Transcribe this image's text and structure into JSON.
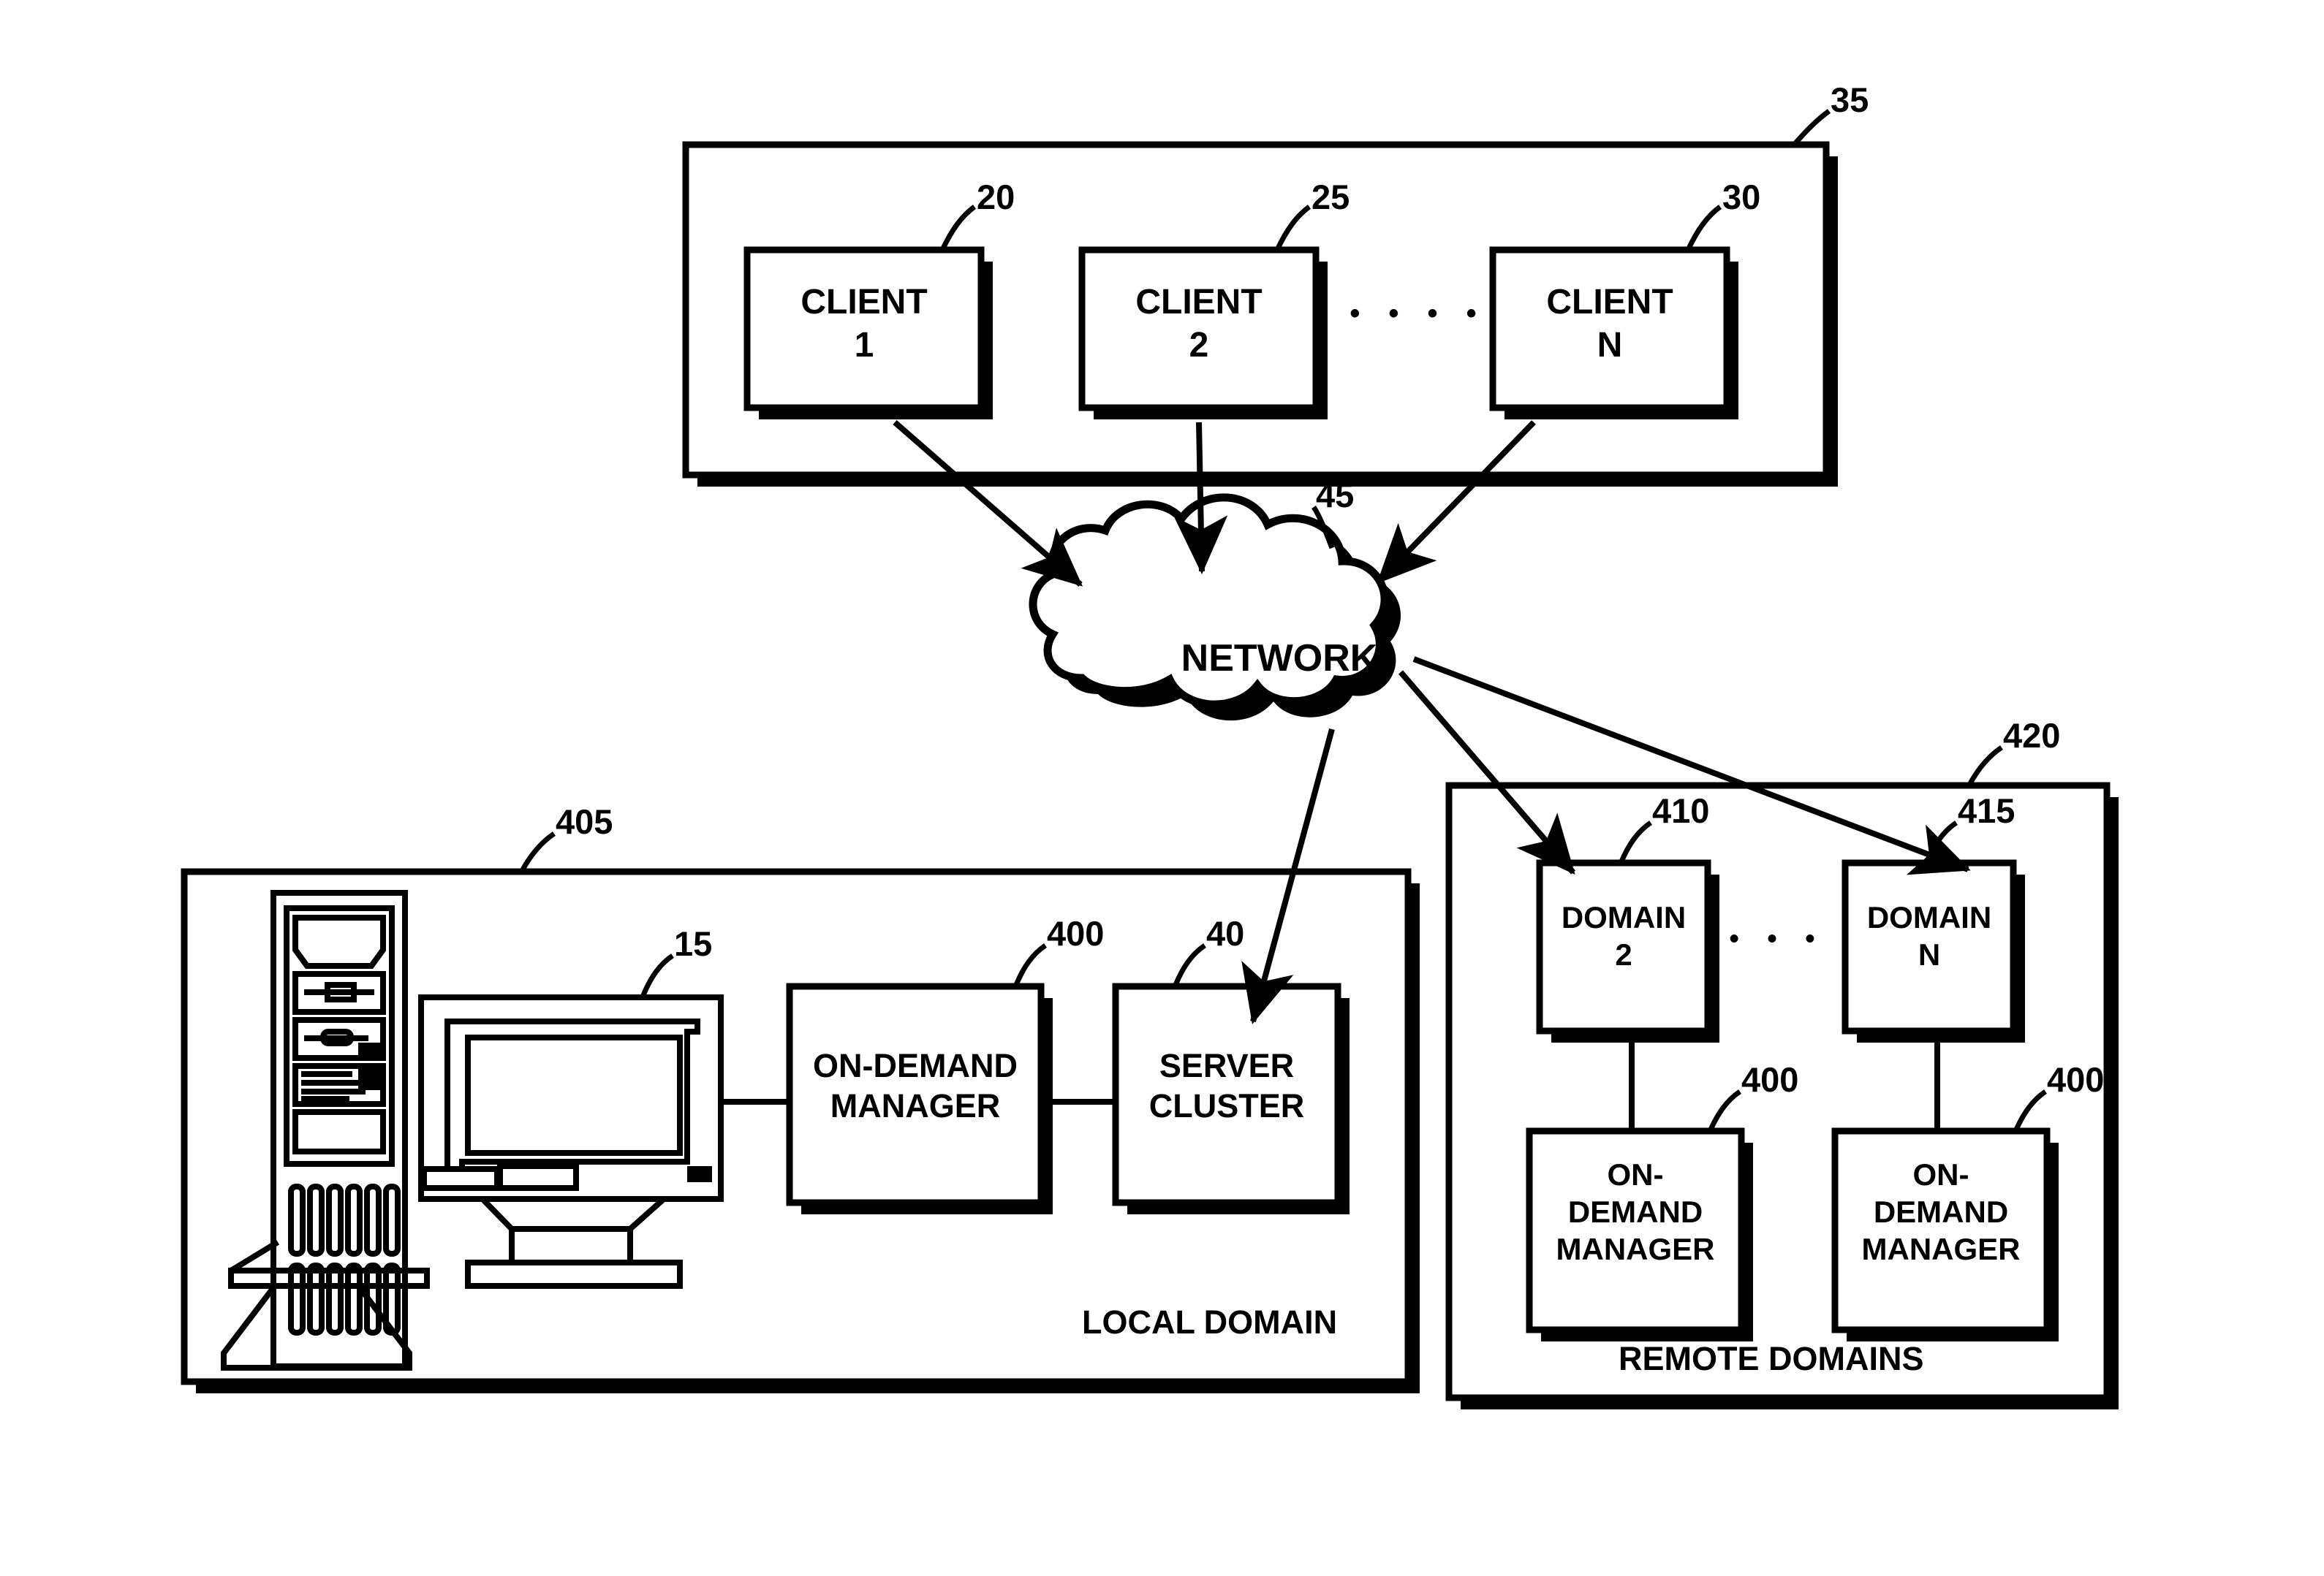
{
  "figure": {
    "type": "patent-block-diagram",
    "background": "#ffffff",
    "ink": "#000000"
  },
  "containers": {
    "clients_group": {
      "ref": "35",
      "label": ""
    },
    "local_domain": {
      "ref": "405",
      "label": "LOCAL DOMAIN"
    },
    "remote_domains": {
      "ref": "420",
      "label": "REMOTE DOMAINS"
    }
  },
  "nodes": {
    "client1": {
      "ref": "20",
      "label": "CLIENT\n1"
    },
    "client2": {
      "ref": "25",
      "label": "CLIENT\n2"
    },
    "clientN": {
      "ref": "30",
      "label": "CLIENT\nN"
    },
    "clients_ellipsis": "• • • •",
    "network": {
      "ref": "45",
      "label": "NETWORK"
    },
    "workstation": {
      "ref": "15",
      "label": ""
    },
    "local_on_demand_manager": {
      "ref": "400",
      "label": "ON-DEMAND\nMANAGER"
    },
    "server_cluster": {
      "ref": "40",
      "label": "SERVER\nCLUSTER"
    },
    "domain2": {
      "ref": "410",
      "label": "DOMAIN\n2"
    },
    "domainN": {
      "ref": "415",
      "label": "DOMAIN\nN"
    },
    "domains_ellipsis": "• • •",
    "remote_manager_2": {
      "ref": "400",
      "label": "ON-\nDEMAND\nMANAGER"
    },
    "remote_manager_n": {
      "ref": "400",
      "label": "ON-\nDEMAND\nMANAGER"
    }
  },
  "edges": [
    {
      "from": "client1",
      "to": "network",
      "arrow": true
    },
    {
      "from": "client2",
      "to": "network",
      "arrow": true
    },
    {
      "from": "clientN",
      "to": "network",
      "arrow": true
    },
    {
      "from": "network",
      "to": "server_cluster",
      "arrow": true
    },
    {
      "from": "network",
      "to": "domain2",
      "arrow": true
    },
    {
      "from": "network",
      "to": "domainN",
      "arrow": true
    },
    {
      "from": "workstation",
      "to": "local_on_demand_manager",
      "arrow": false
    },
    {
      "from": "local_on_demand_manager",
      "to": "server_cluster",
      "arrow": false
    },
    {
      "from": "domain2",
      "to": "remote_manager_2",
      "arrow": false
    },
    {
      "from": "domainN",
      "to": "remote_manager_n",
      "arrow": false
    }
  ]
}
